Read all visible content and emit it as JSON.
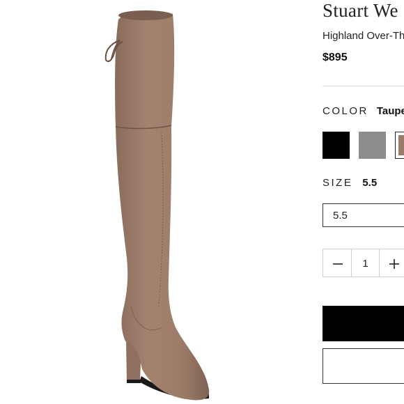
{
  "product": {
    "brand": "Stuart We",
    "name": "Highland Over-Th",
    "price": "$895"
  },
  "color": {
    "label": "COLOR",
    "selected": "Taupe",
    "swatches": [
      {
        "name": "black",
        "hex": "#000000"
      },
      {
        "name": "gray",
        "hex": "#8c8c8a"
      },
      {
        "name": "taupe",
        "hex": "#9b7b6a"
      }
    ]
  },
  "size": {
    "label": "SIZE",
    "selected": "5.5",
    "select_value": "5.5"
  },
  "quantity": {
    "value": "1",
    "decrement_icon": "minus-icon",
    "increment_icon": "plus-icon"
  },
  "colors": {
    "product_color": "#9b7b6a",
    "primary_button": "#000000"
  }
}
